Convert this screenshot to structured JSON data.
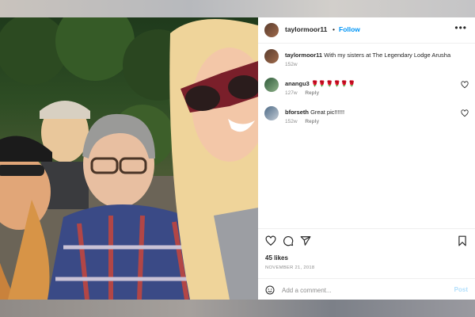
{
  "post": {
    "username": "taylormoor11",
    "follow_label": "Follow",
    "separator": "•",
    "more_label": "•••"
  },
  "caption": {
    "username": "taylormoor11",
    "text": "With my sisters at The Legendary Lodge Arusha",
    "age": "152w"
  },
  "comments": [
    {
      "username": "anangu3",
      "text": "🌹🌹🌹🌹🌹🌹",
      "age": "127w",
      "reply_label": "Reply"
    },
    {
      "username": "bforseth",
      "text": "Great pic!!!!!!",
      "age": "152w",
      "reply_label": "Reply"
    }
  ],
  "likes": "45 likes",
  "date": "NOVEMBER 21, 2018",
  "add_comment": {
    "placeholder": "Add a comment...",
    "post_label": "Post"
  },
  "colors": {
    "accent": "#0095f6",
    "post_disabled": "#b2dffc",
    "muted": "#8e8e8e",
    "text": "#262626"
  },
  "icons": [
    "more-icon",
    "heart-icon",
    "comment-icon",
    "share-icon",
    "bookmark-icon",
    "emoji-icon"
  ]
}
